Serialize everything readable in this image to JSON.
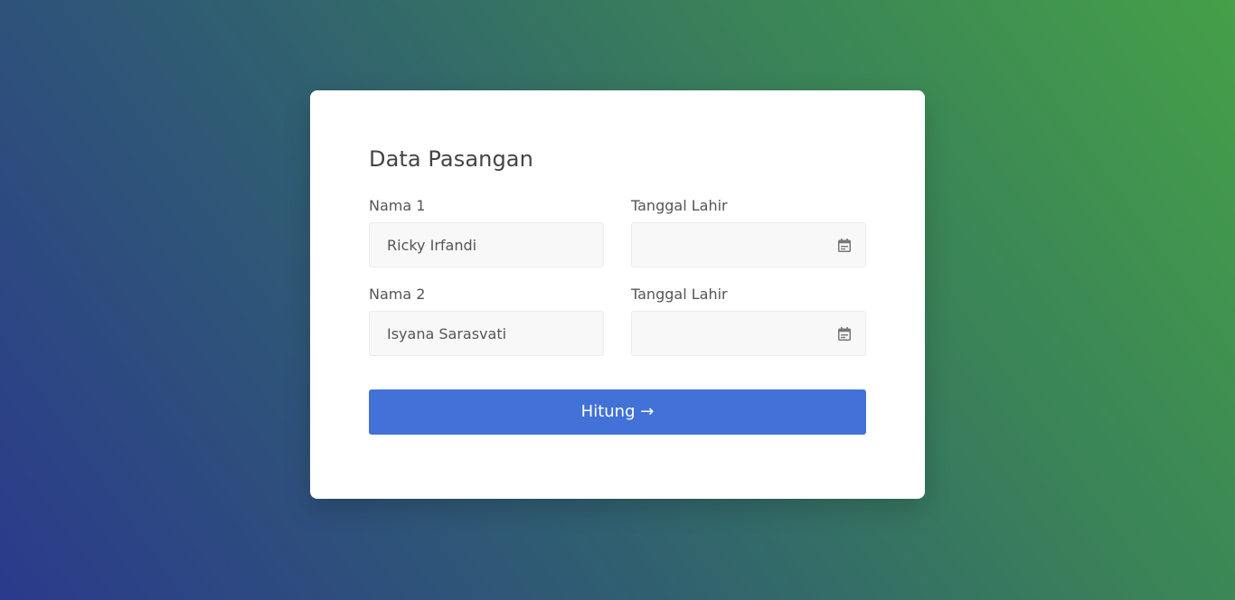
{
  "form": {
    "title": "Data Pasangan",
    "rows": [
      {
        "name_label": "Nama 1",
        "name_value": "Ricky Irfandi",
        "date_label": "Tanggal Lahir",
        "date_value": ""
      },
      {
        "name_label": "Nama 2",
        "name_value": "Isyana Sarasvati",
        "date_label": "Tanggal Lahir",
        "date_value": ""
      }
    ],
    "submit_label": "Hitung →"
  },
  "colors": {
    "button": "#4272d7",
    "background_start": "#2b3a8c",
    "background_end": "#45a048"
  },
  "icons": {
    "date_picker": "calendar-icon"
  }
}
